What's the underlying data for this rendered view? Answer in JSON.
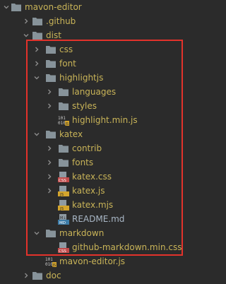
{
  "tree": [
    {
      "label": "mavon-editor",
      "type": "folder",
      "expanded": true,
      "depth": 0
    },
    {
      "label": ".github",
      "type": "folder",
      "expanded": false,
      "depth": 1
    },
    {
      "label": "dist",
      "type": "folder",
      "expanded": true,
      "depth": 1
    },
    {
      "label": "css",
      "type": "folder",
      "expanded": false,
      "depth": 2
    },
    {
      "label": "font",
      "type": "folder",
      "expanded": false,
      "depth": 2
    },
    {
      "label": "highlightjs",
      "type": "folder",
      "expanded": true,
      "depth": 2
    },
    {
      "label": "languages",
      "type": "folder",
      "expanded": false,
      "depth": 3
    },
    {
      "label": "styles",
      "type": "folder",
      "expanded": false,
      "depth": 3
    },
    {
      "label": "highlight.min.js",
      "type": "file",
      "fileicon": "binary-file-icon",
      "depth": 3
    },
    {
      "label": "katex",
      "type": "folder",
      "expanded": true,
      "depth": 2
    },
    {
      "label": "contrib",
      "type": "folder",
      "expanded": false,
      "depth": 3
    },
    {
      "label": "fonts",
      "type": "folder",
      "expanded": false,
      "depth": 3
    },
    {
      "label": "katex.css",
      "type": "folder-file",
      "fileicon": "css-file-icon",
      "depth": 3
    },
    {
      "label": "katex.js",
      "type": "folder-file",
      "fileicon": "js-file-icon",
      "depth": 3
    },
    {
      "label": "katex.mjs",
      "type": "file",
      "fileicon": "js-file-icon",
      "depth": 3
    },
    {
      "label": "README.md",
      "type": "file",
      "fileicon": "md-file-icon",
      "depth": 3
    },
    {
      "label": "markdown",
      "type": "folder",
      "expanded": true,
      "depth": 2
    },
    {
      "label": "github-markdown.min.css",
      "type": "file",
      "fileicon": "css-file-icon",
      "depth": 3
    },
    {
      "label": "mavon-editor.js",
      "type": "file",
      "fileicon": "binary-file-icon",
      "depth": 2
    },
    {
      "label": "doc",
      "type": "folder",
      "expanded": false,
      "depth": 1
    }
  ],
  "colors": {
    "background": "#2b2b2b",
    "folder_label": "#c9b458",
    "highlight_border": "#e3322b",
    "folder_icon": "#87939a"
  }
}
